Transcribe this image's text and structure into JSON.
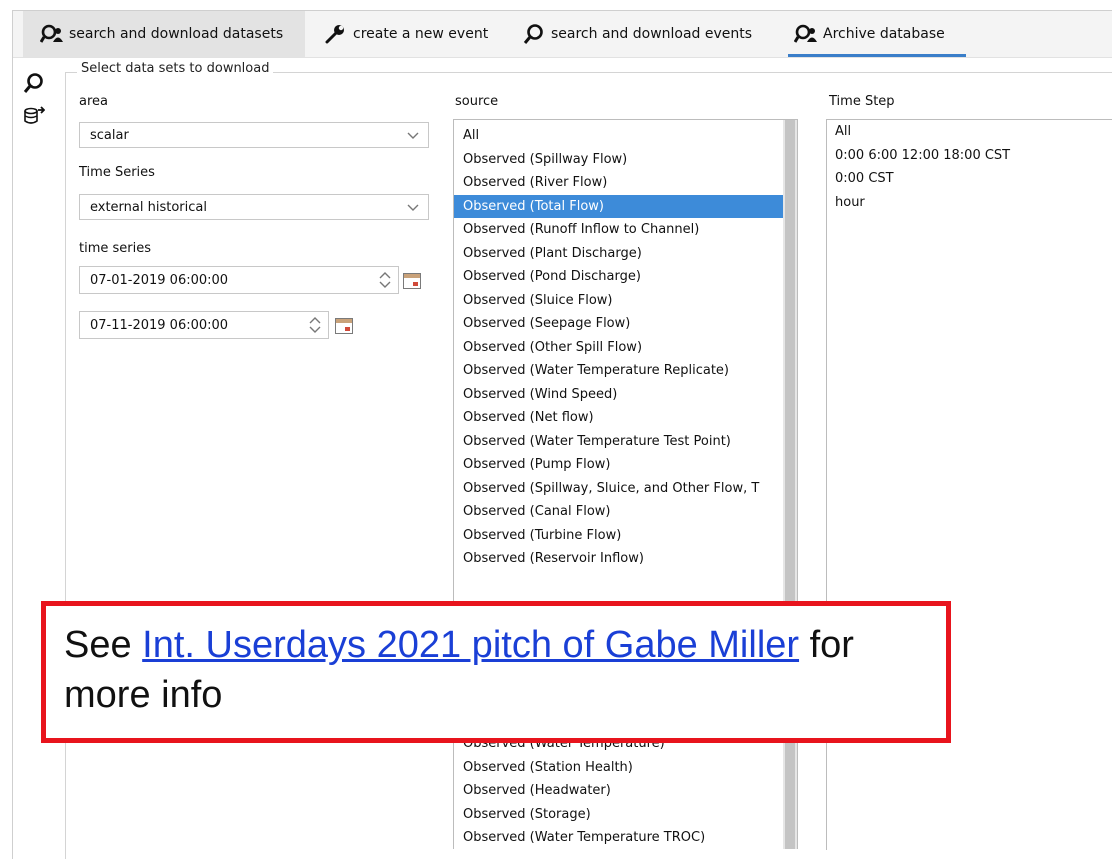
{
  "tabs": [
    {
      "label": "search and download datasets",
      "icon": "person-search-icon",
      "active": false
    },
    {
      "label": "create a new event",
      "icon": "wrench-icon",
      "active": false
    },
    {
      "label": "search and download events",
      "icon": "search-icon",
      "active": false
    },
    {
      "label": "Archive database",
      "icon": "person-search-icon",
      "active": true
    }
  ],
  "sidebar": {
    "icons": [
      "search-icon",
      "database-export-icon"
    ]
  },
  "group_title": "Select data sets to download",
  "area": {
    "label": "area",
    "value": "scalar"
  },
  "time_series_type": {
    "label": "Time Series",
    "value": "external historical"
  },
  "time_range": {
    "label": "time series",
    "start": "07-01-2019 06:00:00",
    "end": "07-11-2019 06:00:00"
  },
  "source": {
    "label": "source",
    "items": [
      "All",
      "Observed (Spillway Flow)",
      "Observed (River Flow)",
      "Observed (Total Flow)",
      "Observed (Runoff Inflow to Channel)",
      "Observed (Plant Discharge)",
      "Observed (Pond Discharge)",
      "Observed (Sluice Flow)",
      "Observed (Seepage Flow)",
      "Observed (Other Spill Flow)",
      "Observed (Water Temperature Replicate)",
      "Observed (Wind Speed)",
      "Observed (Net flow)",
      "Observed (Water Temperature Test Point)",
      "Observed (Pump Flow)",
      "Observed (Spillway, Sluice, and Other Flow, T",
      "Observed (Canal Flow)",
      "Observed (Turbine Flow)",
      "Observed (Reservoir Inflow)",
      "Observed (Water Temperature)",
      "Observed (Station Health)",
      "Observed (Headwater)",
      "Observed (Storage)",
      "Observed (Water Temperature TROC)"
    ],
    "selected_index": 3
  },
  "time_step": {
    "label": "Time Step",
    "items": [
      "All",
      "0:00 6:00 12:00 18:00 CST",
      "0:00 CST",
      "hour"
    ]
  },
  "callout": {
    "prefix": "See ",
    "link_text": "Int. Userdays 2021 pitch of Gabe Miller",
    "suffix": " for more info"
  },
  "colors": {
    "selection": "#3d8bd9",
    "callout_border": "#e8141d",
    "link": "#1a3fd6",
    "tab_underline": "#3a7ec9"
  }
}
